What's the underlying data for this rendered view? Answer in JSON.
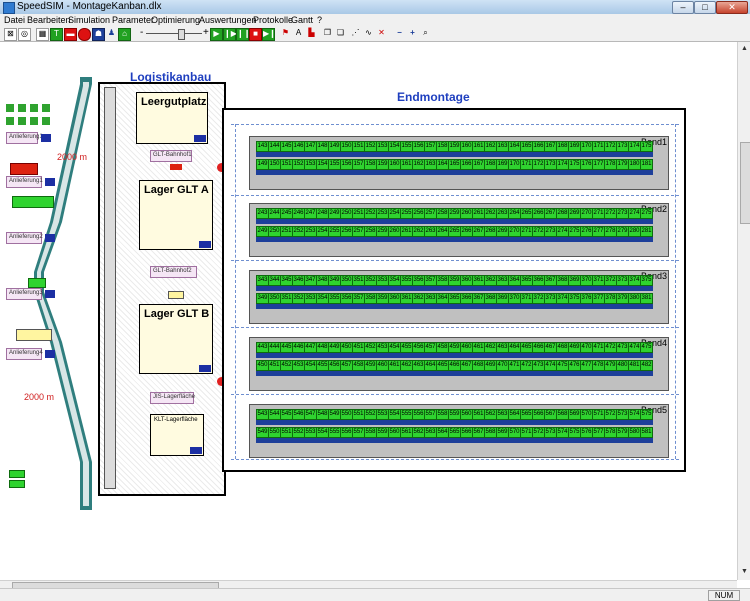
{
  "window": {
    "title": "SpeedSIM - MontageKanban.dlx",
    "min": "–",
    "max": "□",
    "close": "✕"
  },
  "menu": [
    "Datei",
    "Bearbeiten",
    "Simulation",
    "Parameter",
    "Optimierung",
    "Auswertungen",
    "Protokolle",
    "Gantt",
    "?"
  ],
  "toolbar": {
    "icons": [
      "select-icon",
      "zoom-region-icon",
      "grid-icon",
      "text-icon",
      "truck-icon",
      "record-icon",
      "person-icon",
      "worker-icon",
      "forklift-icon",
      "minus-icon",
      "plus-icon",
      "play-icon",
      "step-icon",
      "pause-icon",
      "stop-icon",
      "record-stop-icon",
      "play-end-icon",
      "route-icon",
      "ab-icon",
      "flag-icon",
      "copy-icon",
      "paste-icon",
      "nodes-icon",
      "link-icon",
      "unlink-icon",
      "zoom-out-icon",
      "zoom-in-icon",
      "magnify-icon"
    ],
    "slider_minus": "-",
    "slider_plus": "+"
  },
  "layout": {
    "logistik_title": "Logistikanbau",
    "endmontage_title": "Endmontage",
    "distance_top": "2000 m",
    "distance_bottom": "2000 m",
    "leergutplatz": "Leergutplatz",
    "lager_a": "Lager GLT A",
    "lager_b": "Lager GLT B",
    "glt_bahnhof1": "GLT-Bahnhof1",
    "glt_bahnhof2": "GLT-Bahnhof2",
    "jis_lager": "JIS-Lagerfläche",
    "klt_lager": "KLT-Lagerfläche",
    "source_labels": [
      "Anlieferung1",
      "Anlieferung1",
      "Anlieferung2",
      "Anlieferung3",
      "Anlieferung4"
    ]
  },
  "bands": [
    {
      "label": "Band1",
      "top": [
        143,
        144,
        145,
        146,
        147,
        148,
        149,
        150,
        151,
        152,
        153,
        154,
        155,
        156,
        157,
        158,
        159,
        160,
        161,
        162,
        163,
        164,
        165,
        166,
        167,
        168,
        169,
        170,
        171,
        172,
        173,
        174,
        175
      ],
      "bottom": [
        149,
        150,
        151,
        152,
        153,
        154,
        155,
        156,
        157,
        158,
        159,
        160,
        161,
        162,
        163,
        164,
        165,
        166,
        167,
        168,
        169,
        170,
        171,
        172,
        173,
        174,
        175,
        176,
        177,
        178,
        179,
        180,
        181
      ]
    },
    {
      "label": "Band2",
      "top": [
        243,
        244,
        245,
        246,
        247,
        248,
        249,
        250,
        251,
        252,
        253,
        254,
        255,
        256,
        257,
        258,
        259,
        260,
        261,
        262,
        263,
        264,
        265,
        266,
        267,
        268,
        269,
        270,
        271,
        272,
        273,
        274,
        275
      ],
      "bottom": [
        249,
        250,
        251,
        252,
        253,
        254,
        255,
        256,
        257,
        258,
        259,
        260,
        261,
        262,
        263,
        264,
        265,
        266,
        267,
        268,
        269,
        270,
        271,
        272,
        273,
        274,
        275,
        276,
        277,
        278,
        279,
        280,
        281
      ]
    },
    {
      "label": "Band3",
      "top": [
        343,
        344,
        345,
        346,
        347,
        348,
        349,
        350,
        351,
        352,
        353,
        354,
        355,
        356,
        357,
        358,
        359,
        360,
        361,
        362,
        363,
        364,
        365,
        366,
        367,
        368,
        369,
        370,
        371,
        372,
        373,
        374,
        375
      ],
      "bottom": [
        349,
        350,
        351,
        352,
        353,
        354,
        355,
        356,
        357,
        358,
        359,
        360,
        361,
        362,
        363,
        364,
        365,
        366,
        367,
        368,
        369,
        370,
        371,
        372,
        373,
        374,
        375,
        376,
        377,
        378,
        379,
        380,
        381
      ]
    },
    {
      "label": "Band4",
      "top": [
        443,
        444,
        445,
        446,
        447,
        448,
        449,
        450,
        451,
        452,
        453,
        454,
        455,
        456,
        457,
        458,
        459,
        460,
        461,
        462,
        463,
        464,
        465,
        466,
        467,
        468,
        469,
        470,
        471,
        472,
        473,
        474,
        475
      ],
      "bottom": [
        450,
        451,
        452,
        453,
        454,
        455,
        456,
        457,
        458,
        459,
        460,
        461,
        462,
        463,
        464,
        465,
        466,
        467,
        468,
        469,
        470,
        471,
        472,
        473,
        474,
        475,
        476,
        477,
        478,
        479,
        480,
        481,
        482
      ]
    },
    {
      "label": "Band5",
      "top": [
        543,
        544,
        545,
        546,
        547,
        548,
        549,
        550,
        551,
        552,
        553,
        554,
        555,
        556,
        557,
        558,
        559,
        560,
        561,
        562,
        563,
        564,
        565,
        566,
        567,
        568,
        569,
        570,
        571,
        572,
        573,
        574,
        575
      ],
      "bottom": [
        549,
        550,
        551,
        552,
        553,
        554,
        555,
        556,
        557,
        558,
        559,
        560,
        561,
        562,
        563,
        564,
        565,
        566,
        567,
        568,
        569,
        570,
        571,
        572,
        573,
        574,
        575,
        576,
        577,
        578,
        579,
        580,
        581
      ]
    }
  ],
  "status": {
    "num": "NUM"
  },
  "colors": {
    "accent_blue": "#1f3fbf",
    "station_green": "#2fd32f",
    "band_grey": "#c0c0c0",
    "distance_red": "#d02020"
  }
}
